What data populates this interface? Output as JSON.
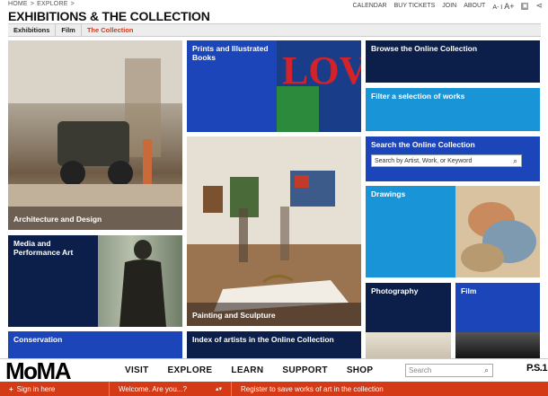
{
  "breadcrumb": [
    "HOME",
    ">",
    "EXPLORE",
    ">"
  ],
  "top_links": [
    "CALENDAR",
    "BUY TICKETS",
    "JOIN",
    "ABOUT",
    "A-",
    "I",
    "A+"
  ],
  "page_title": "EXHIBITIONS & THE COLLECTION",
  "subnav": [
    "Exhibitions",
    "Film",
    "The Collection"
  ],
  "tiles": {
    "architecture": "Architecture and Design",
    "media": "Media and Performance Art",
    "conservation": "Conservation",
    "prints": "Prints and Illustrated Books",
    "love": "LOVE",
    "painting": "Painting and Sculpture",
    "index": "Index of artists in the Online Collection",
    "browse": "Browse the Online Collection",
    "filter": "Filter a selection of works",
    "search_title": "Search the Online Collection",
    "search_placeholder": "Search by Artist, Work, or Keyword",
    "drawings": "Drawings",
    "photography": "Photography",
    "film": "Film"
  },
  "footer": {
    "logo": "MoMA",
    "nav": [
      "VISIT",
      "EXPLORE",
      "LEARN",
      "SUPPORT",
      "SHOP"
    ],
    "search_placeholder": "Search",
    "ps1": "P.S.1",
    "sign_in": "Sign in here",
    "welcome": "Welcome. Are you...?",
    "register": "Register to save works of art in the collection"
  },
  "colors": {
    "accent": "#d43a16",
    "blue": "#1b45b8",
    "navy": "#0b1f4a",
    "light_blue": "#1994d6"
  }
}
